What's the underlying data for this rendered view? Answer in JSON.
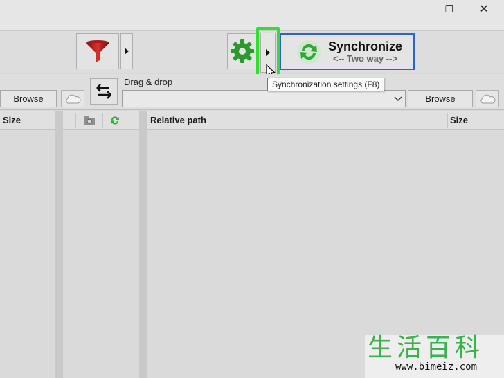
{
  "window": {
    "controls": [
      "minimize-icon",
      "restore-icon",
      "close-icon"
    ],
    "minimize_glyph": "—",
    "restore_glyph": "❐",
    "close_glyph": "✕"
  },
  "toolbar": {
    "filter_icon": "filter-icon",
    "settings_icon": "gear-icon",
    "sync_title": "Synchronize",
    "sync_subtitle": "<-- Two way -->",
    "tooltip": "Synchronization settings (F8)"
  },
  "folder_bar": {
    "left_browse": "Browse",
    "swap_icon": "swap-arrows-icon",
    "drag_label": "Drag & drop",
    "right_browse": "Browse",
    "combo_value": ""
  },
  "grid": {
    "left_header": "Size",
    "middle_icons": [
      "folder-compare-icon",
      "sync-icon"
    ],
    "right_header_path": "Relative path",
    "right_header_size": "Size"
  },
  "watermark": {
    "text": "生活百科",
    "url": "www.bimeiz.com"
  },
  "colors": {
    "accent": "#2c64c8",
    "highlight": "#33dd33",
    "sync_green": "#2fa838",
    "filter_red": "#b01c1c"
  }
}
